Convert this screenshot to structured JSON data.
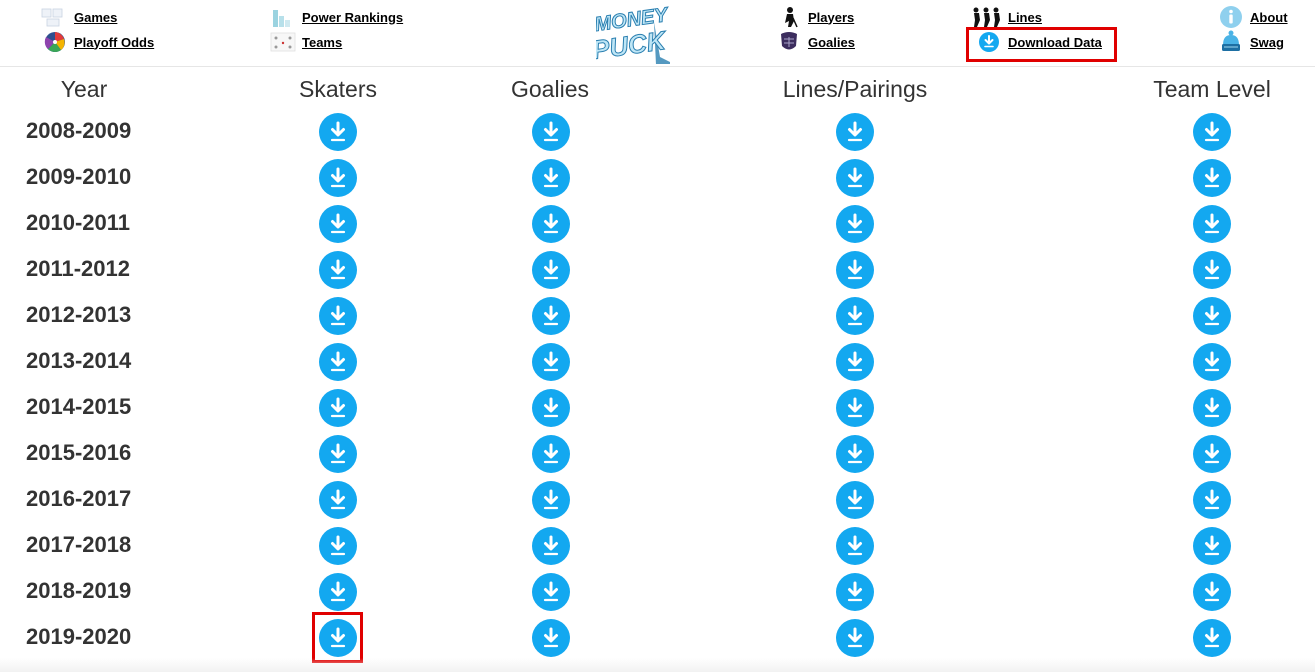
{
  "nav": {
    "games": "Games",
    "playoff_odds": "Playoff Odds",
    "power_rankings": "Power Rankings",
    "teams": "Teams",
    "players": "Players",
    "goalies": "Goalies",
    "lines": "Lines",
    "download_data": "Download Data",
    "about": "About",
    "swag": "Swag"
  },
  "logo": {
    "line1": "MONEY",
    "line2": "PUCK"
  },
  "table": {
    "headers": [
      "Year",
      "Skaters",
      "Goalies",
      "Lines/Pairings",
      "Team Level"
    ],
    "years": [
      "2008-2009",
      "2009-2010",
      "2010-2011",
      "2011-2012",
      "2012-2013",
      "2013-2014",
      "2014-2015",
      "2015-2016",
      "2016-2017",
      "2017-2018",
      "2018-2019",
      "2019-2020"
    ]
  },
  "colors": {
    "accent": "#13a8f0",
    "highlight": "#e00000"
  },
  "icons": {
    "games": "games-icon",
    "playoff_odds": "wheel-icon",
    "power_rankings": "bar-chart-icon",
    "teams": "teams-icon",
    "players": "player-icon",
    "goalies": "goalie-mask-icon",
    "lines": "line-players-icon",
    "download_data": "download-icon",
    "about": "info-icon",
    "swag": "hat-icon"
  }
}
